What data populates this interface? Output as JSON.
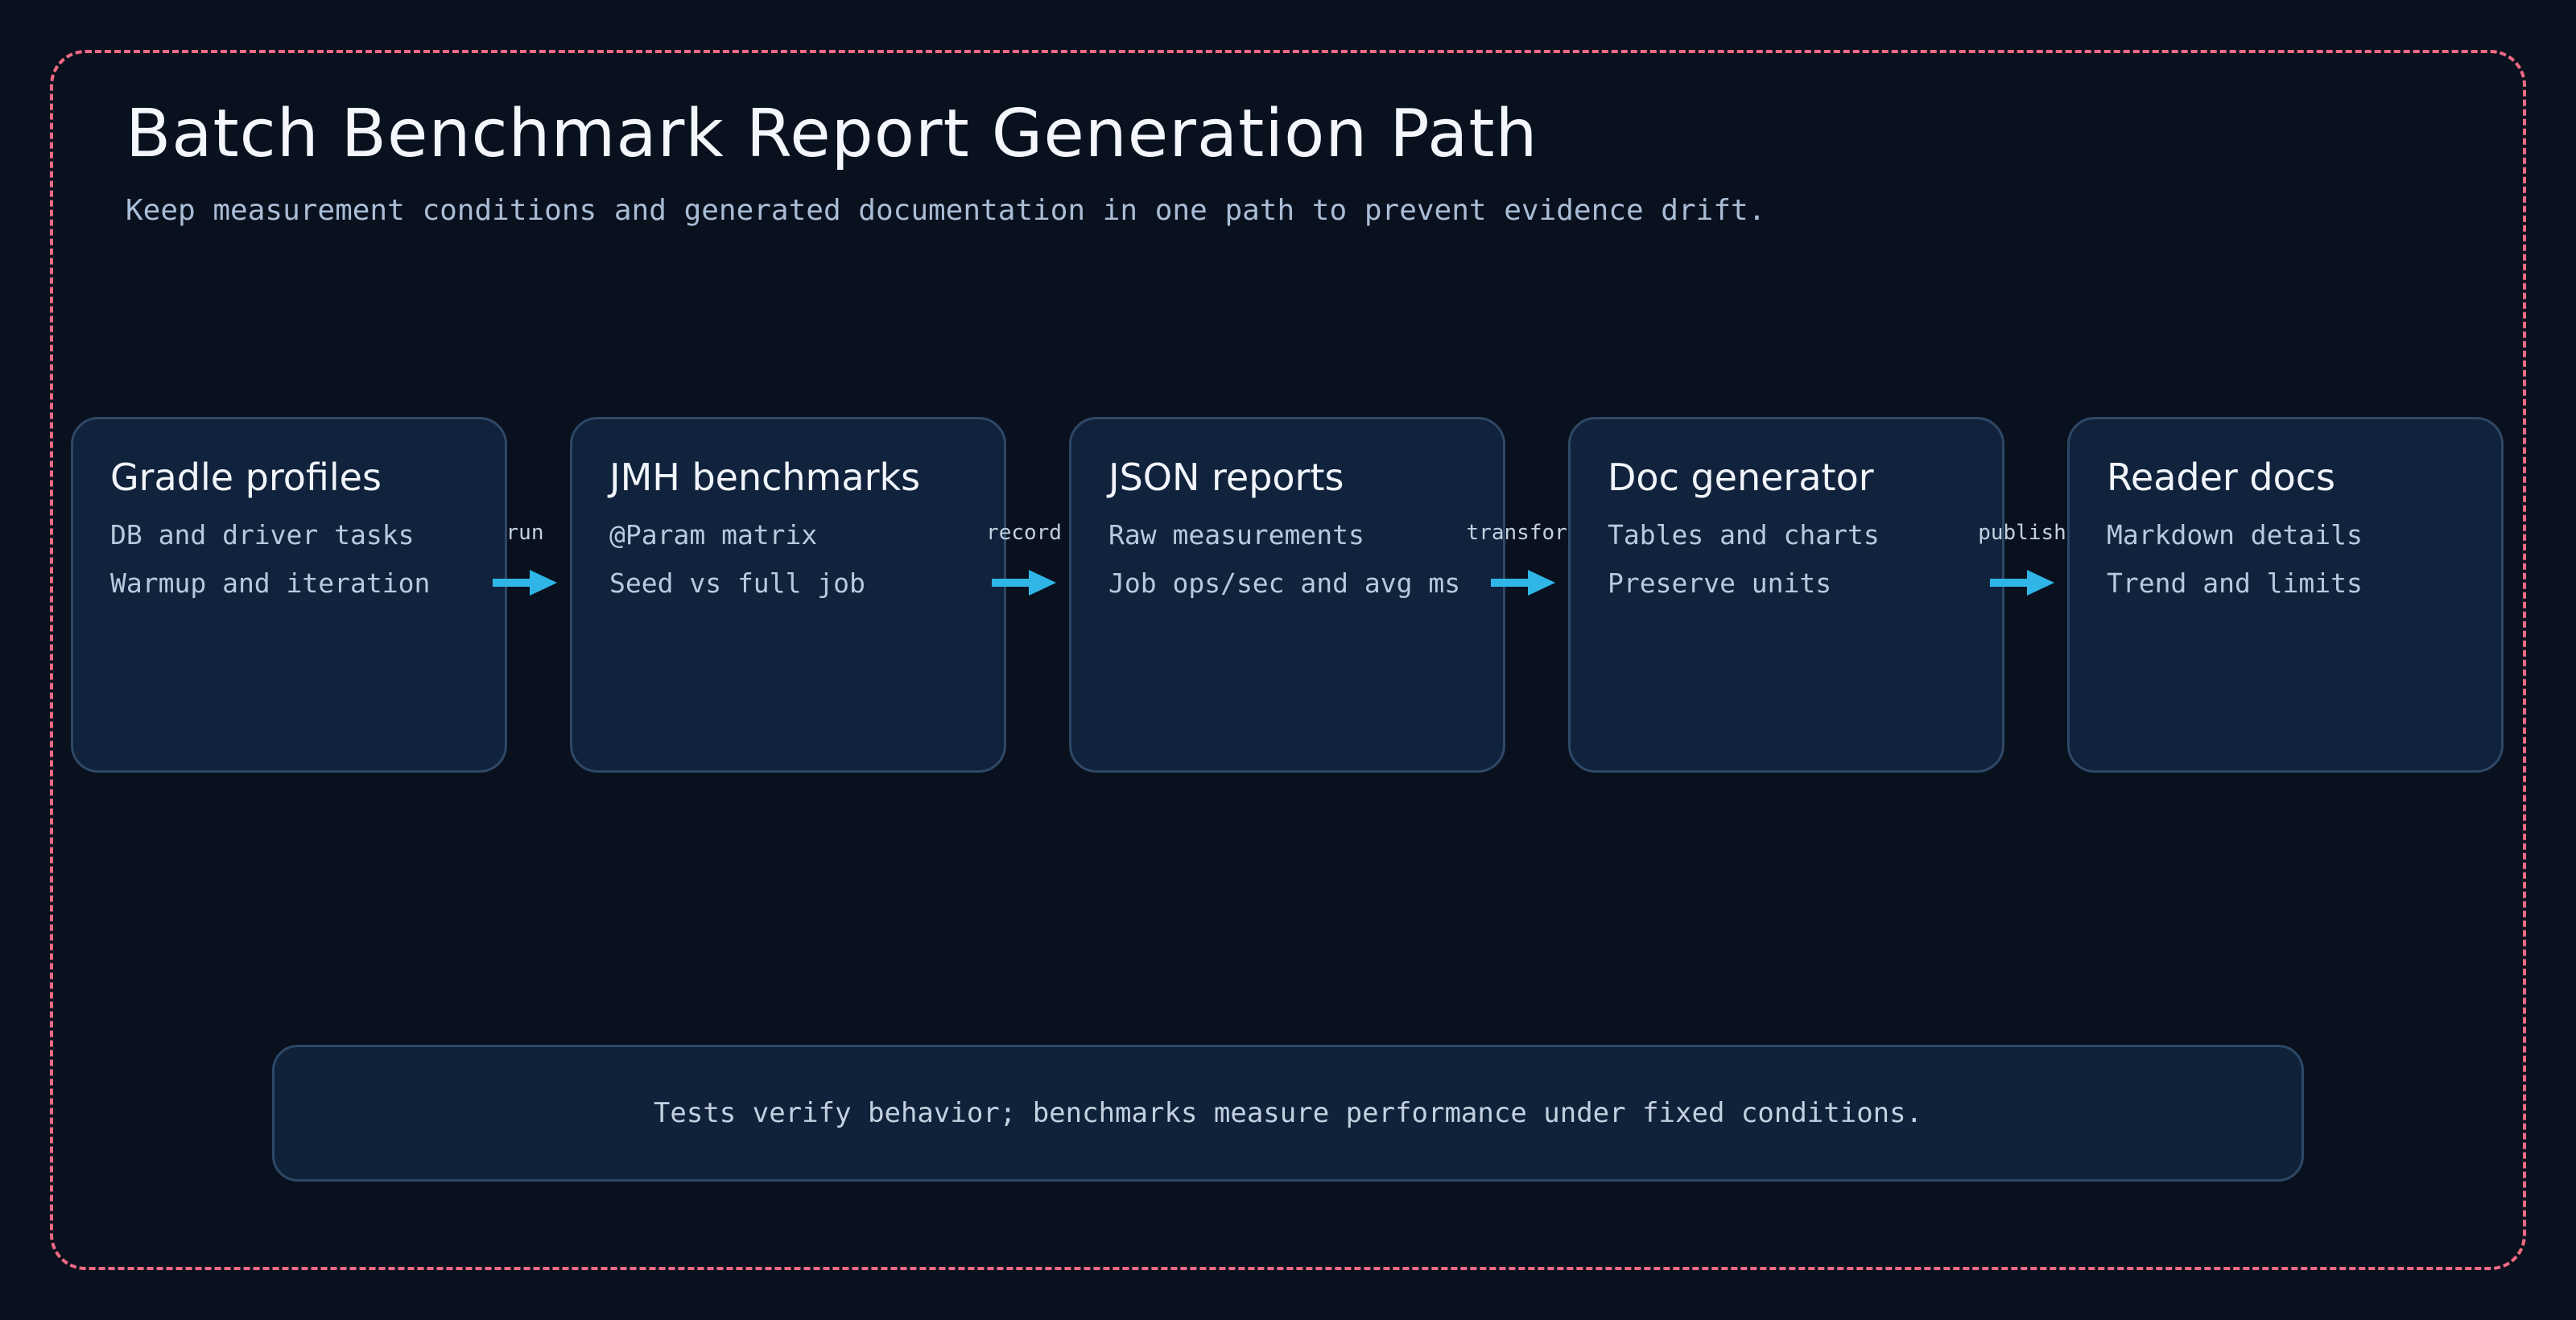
{
  "title": "Batch Benchmark Report Generation Path",
  "subtitle": "Keep measurement conditions and generated documentation in one path to prevent evidence drift.",
  "colors": {
    "background": "#0a111e",
    "frame_border": "#f06a84",
    "node_fill": "#11233c",
    "node_border": "#2e4866",
    "arrow": "#2fb6e6"
  },
  "nodes": [
    {
      "title": "Gradle profiles",
      "lines": [
        "DB and driver tasks",
        "Warmup and iteration"
      ]
    },
    {
      "title": "JMH benchmarks",
      "lines": [
        "@Param matrix",
        "Seed vs full job"
      ]
    },
    {
      "title": "JSON reports",
      "lines": [
        "Raw measurements",
        "Job ops/sec and avg ms"
      ]
    },
    {
      "title": "Doc generator",
      "lines": [
        "Tables and charts",
        "Preserve units"
      ]
    },
    {
      "title": "Reader docs",
      "lines": [
        "Markdown details",
        "Trend and limits"
      ]
    }
  ],
  "edges": [
    {
      "label": "run"
    },
    {
      "label": "record"
    },
    {
      "label": "transform"
    },
    {
      "label": "publish"
    }
  ],
  "note": "Tests verify behavior; benchmarks measure performance under fixed conditions."
}
